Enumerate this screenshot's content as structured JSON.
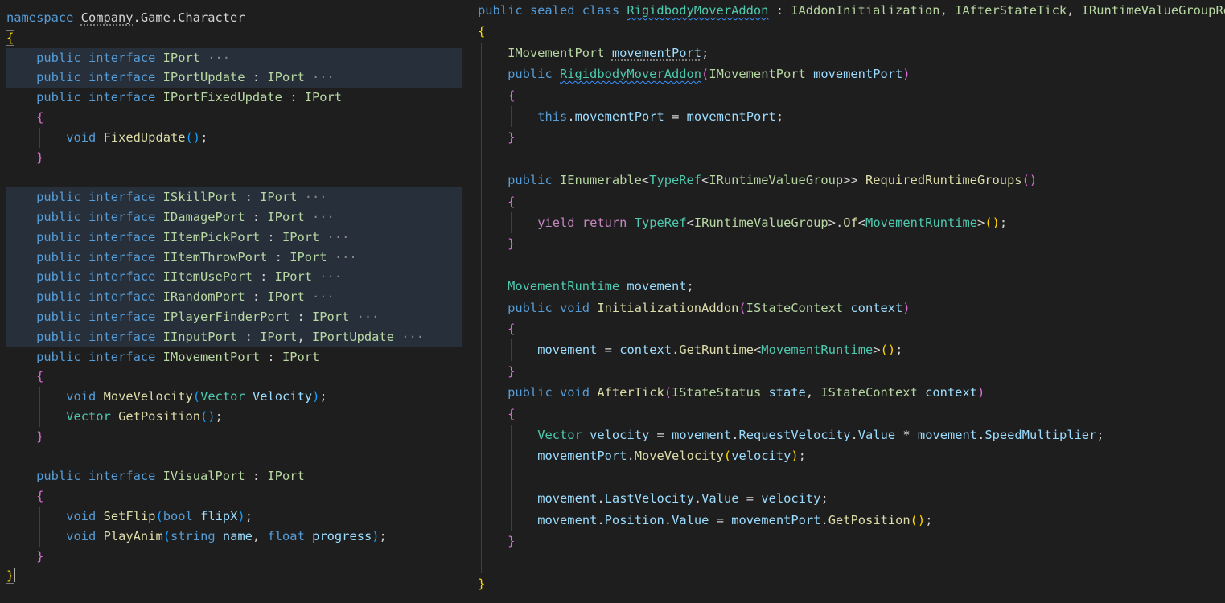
{
  "theme": {
    "keyword": "#569cd6",
    "control": "#c586c0",
    "type": "#4ec9b0",
    "iface": "#b8d7a3",
    "method": "#dcdcaa",
    "variable": "#9cdcfe",
    "text": "#d4d4d4",
    "brace1": "#ffd700",
    "brace2": "#da70d6",
    "brace3": "#179fff",
    "fold": "#8a8a8a"
  },
  "left_lines": [
    {
      "indent": 0,
      "hl": false,
      "tokens": [
        [
          "namespace ",
          "keyword"
        ],
        [
          "Company",
          "text",
          "dotted"
        ],
        [
          ".Game.Character",
          "text"
        ]
      ]
    },
    {
      "indent": 0,
      "hl": false,
      "tokens": [
        [
          "{",
          "brace1",
          "box"
        ]
      ]
    },
    {
      "indent": 1,
      "hl": true,
      "tokens": [
        [
          "public ",
          "keyword"
        ],
        [
          "interface ",
          "keyword"
        ],
        [
          "IPort",
          "iface"
        ],
        [
          " ···",
          "fold"
        ]
      ]
    },
    {
      "indent": 1,
      "hl": true,
      "tokens": [
        [
          "public ",
          "keyword"
        ],
        [
          "interface ",
          "keyword"
        ],
        [
          "IPortUpdate",
          "iface"
        ],
        [
          " : ",
          "text"
        ],
        [
          "IPort",
          "iface"
        ],
        [
          " ···",
          "fold"
        ]
      ]
    },
    {
      "indent": 1,
      "hl": false,
      "tokens": [
        [
          "public ",
          "keyword"
        ],
        [
          "interface ",
          "keyword"
        ],
        [
          "IPortFixedUpdate",
          "iface"
        ],
        [
          " : ",
          "text"
        ],
        [
          "IPort",
          "iface"
        ]
      ]
    },
    {
      "indent": 1,
      "hl": false,
      "tokens": [
        [
          "{",
          "brace2"
        ]
      ]
    },
    {
      "indent": 2,
      "hl": false,
      "tokens": [
        [
          "void ",
          "keyword"
        ],
        [
          "FixedUpdate",
          "method"
        ],
        [
          "()",
          "brace3"
        ],
        [
          ";",
          "text"
        ]
      ]
    },
    {
      "indent": 1,
      "hl": false,
      "tokens": [
        [
          "}",
          "brace2"
        ]
      ]
    },
    {
      "indent": 0,
      "hl": false,
      "tokens": []
    },
    {
      "indent": 1,
      "hl": true,
      "tokens": [
        [
          "public ",
          "keyword"
        ],
        [
          "interface ",
          "keyword"
        ],
        [
          "ISkillPort",
          "iface"
        ],
        [
          " : ",
          "text"
        ],
        [
          "IPort",
          "iface"
        ],
        [
          " ···",
          "fold"
        ]
      ]
    },
    {
      "indent": 1,
      "hl": true,
      "tokens": [
        [
          "public ",
          "keyword"
        ],
        [
          "interface ",
          "keyword"
        ],
        [
          "IDamagePort",
          "iface"
        ],
        [
          " : ",
          "text"
        ],
        [
          "IPort",
          "iface"
        ],
        [
          " ···",
          "fold"
        ]
      ]
    },
    {
      "indent": 1,
      "hl": true,
      "tokens": [
        [
          "public ",
          "keyword"
        ],
        [
          "interface ",
          "keyword"
        ],
        [
          "IItemPickPort",
          "iface"
        ],
        [
          " : ",
          "text"
        ],
        [
          "IPort",
          "iface"
        ],
        [
          " ···",
          "fold"
        ]
      ]
    },
    {
      "indent": 1,
      "hl": true,
      "tokens": [
        [
          "public ",
          "keyword"
        ],
        [
          "interface ",
          "keyword"
        ],
        [
          "IItemThrowPort",
          "iface"
        ],
        [
          " : ",
          "text"
        ],
        [
          "IPort",
          "iface"
        ],
        [
          " ···",
          "fold"
        ]
      ]
    },
    {
      "indent": 1,
      "hl": true,
      "tokens": [
        [
          "public ",
          "keyword"
        ],
        [
          "interface ",
          "keyword"
        ],
        [
          "IItemUsePort",
          "iface"
        ],
        [
          " : ",
          "text"
        ],
        [
          "IPort",
          "iface"
        ],
        [
          " ···",
          "fold"
        ]
      ]
    },
    {
      "indent": 1,
      "hl": true,
      "tokens": [
        [
          "public ",
          "keyword"
        ],
        [
          "interface ",
          "keyword"
        ],
        [
          "IRandomPort",
          "iface"
        ],
        [
          " : ",
          "text"
        ],
        [
          "IPort",
          "iface"
        ],
        [
          " ···",
          "fold"
        ]
      ]
    },
    {
      "indent": 1,
      "hl": true,
      "tokens": [
        [
          "public ",
          "keyword"
        ],
        [
          "interface ",
          "keyword"
        ],
        [
          "IPlayerFinderPort",
          "iface"
        ],
        [
          " : ",
          "text"
        ],
        [
          "IPort",
          "iface"
        ],
        [
          " ···",
          "fold"
        ]
      ]
    },
    {
      "indent": 1,
      "hl": true,
      "tokens": [
        [
          "public ",
          "keyword"
        ],
        [
          "interface ",
          "keyword"
        ],
        [
          "IInputPort",
          "iface"
        ],
        [
          " : ",
          "text"
        ],
        [
          "IPort",
          "iface"
        ],
        [
          ", ",
          "text"
        ],
        [
          "IPortUpdate",
          "iface"
        ],
        [
          " ···",
          "fold"
        ]
      ]
    },
    {
      "indent": 1,
      "hl": false,
      "tokens": [
        [
          "public ",
          "keyword"
        ],
        [
          "interface ",
          "keyword"
        ],
        [
          "IMovementPort",
          "iface"
        ],
        [
          " : ",
          "text"
        ],
        [
          "IPort",
          "iface"
        ]
      ]
    },
    {
      "indent": 1,
      "hl": false,
      "tokens": [
        [
          "{",
          "brace2"
        ]
      ]
    },
    {
      "indent": 2,
      "hl": false,
      "tokens": [
        [
          "void ",
          "keyword"
        ],
        [
          "MoveVelocity",
          "method"
        ],
        [
          "(",
          "brace3"
        ],
        [
          "Vector ",
          "type"
        ],
        [
          "Velocity",
          "variable"
        ],
        [
          ")",
          "brace3"
        ],
        [
          ";",
          "text"
        ]
      ]
    },
    {
      "indent": 2,
      "hl": false,
      "tokens": [
        [
          "Vector ",
          "type"
        ],
        [
          "GetPosition",
          "method"
        ],
        [
          "()",
          "brace3"
        ],
        [
          ";",
          "text"
        ]
      ]
    },
    {
      "indent": 1,
      "hl": false,
      "tokens": [
        [
          "}",
          "brace2"
        ]
      ]
    },
    {
      "indent": 0,
      "hl": false,
      "tokens": []
    },
    {
      "indent": 1,
      "hl": false,
      "tokens": [
        [
          "public ",
          "keyword"
        ],
        [
          "interface ",
          "keyword"
        ],
        [
          "IVisualPort",
          "iface"
        ],
        [
          " : ",
          "text"
        ],
        [
          "IPort",
          "iface"
        ]
      ]
    },
    {
      "indent": 1,
      "hl": false,
      "tokens": [
        [
          "{",
          "brace2"
        ]
      ]
    },
    {
      "indent": 2,
      "hl": false,
      "tokens": [
        [
          "void ",
          "keyword"
        ],
        [
          "SetFlip",
          "method"
        ],
        [
          "(",
          "brace3"
        ],
        [
          "bool ",
          "keyword"
        ],
        [
          "flipX",
          "variable"
        ],
        [
          ")",
          "brace3"
        ],
        [
          ";",
          "text"
        ]
      ]
    },
    {
      "indent": 2,
      "hl": false,
      "tokens": [
        [
          "void ",
          "keyword"
        ],
        [
          "PlayAnim",
          "method"
        ],
        [
          "(",
          "brace3"
        ],
        [
          "string ",
          "keyword"
        ],
        [
          "name",
          "variable"
        ],
        [
          ", ",
          "text"
        ],
        [
          "float ",
          "keyword"
        ],
        [
          "progress",
          "variable"
        ],
        [
          ")",
          "brace3"
        ],
        [
          ";",
          "text"
        ]
      ]
    },
    {
      "indent": 1,
      "hl": false,
      "tokens": [
        [
          "}",
          "brace2"
        ]
      ]
    },
    {
      "indent": 0,
      "hl": false,
      "tokens": [
        [
          "}",
          "brace1",
          "box"
        ],
        [
          "",
          "cursor"
        ]
      ]
    }
  ],
  "right_lines": [
    {
      "indent": 0,
      "tokens": [
        [
          "public ",
          "keyword"
        ],
        [
          "sealed ",
          "keyword"
        ],
        [
          "class ",
          "keyword"
        ],
        [
          "RigidbodyMoverAddon",
          "type",
          "squiggle"
        ],
        [
          " : ",
          "text"
        ],
        [
          "IAddonInitialization",
          "iface"
        ],
        [
          ", ",
          "text"
        ],
        [
          "IAfterStateTick",
          "iface"
        ],
        [
          ", ",
          "text"
        ],
        [
          "IRuntimeValueGroupRequirer",
          "iface"
        ]
      ]
    },
    {
      "indent": 0,
      "tokens": [
        [
          "{",
          "brace1"
        ]
      ]
    },
    {
      "indent": 1,
      "tokens": [
        [
          "IMovementPort ",
          "iface"
        ],
        [
          "movementPort",
          "variable",
          "dotted"
        ],
        [
          ";",
          "text"
        ]
      ]
    },
    {
      "indent": 1,
      "tokens": [
        [
          "public ",
          "keyword"
        ],
        [
          "RigidbodyMoverAddon",
          "type",
          "squiggle"
        ],
        [
          "(",
          "brace2"
        ],
        [
          "IMovementPort ",
          "iface"
        ],
        [
          "movementPort",
          "variable"
        ],
        [
          ")",
          "brace2"
        ]
      ]
    },
    {
      "indent": 1,
      "tokens": [
        [
          "{",
          "brace2"
        ]
      ]
    },
    {
      "indent": 2,
      "tokens": [
        [
          "this",
          "keyword"
        ],
        [
          ".",
          "text"
        ],
        [
          "movementPort",
          "variable"
        ],
        [
          " = ",
          "text"
        ],
        [
          "movementPort",
          "variable"
        ],
        [
          ";",
          "text"
        ]
      ]
    },
    {
      "indent": 1,
      "tokens": [
        [
          "}",
          "brace2"
        ]
      ]
    },
    {
      "indent": 0,
      "tokens": []
    },
    {
      "indent": 1,
      "tokens": [
        [
          "public ",
          "keyword"
        ],
        [
          "IEnumerable",
          "iface"
        ],
        [
          "<",
          "text"
        ],
        [
          "TypeRef",
          "type"
        ],
        [
          "<",
          "text"
        ],
        [
          "IRuntimeValueGroup",
          "iface"
        ],
        [
          ">> ",
          "text"
        ],
        [
          "RequiredRuntimeGroups",
          "method"
        ],
        [
          "()",
          "brace2"
        ]
      ]
    },
    {
      "indent": 1,
      "tokens": [
        [
          "{",
          "brace2"
        ]
      ]
    },
    {
      "indent": 2,
      "tokens": [
        [
          "yield ",
          "control"
        ],
        [
          "return ",
          "control"
        ],
        [
          "TypeRef",
          "type"
        ],
        [
          "<",
          "text"
        ],
        [
          "IRuntimeValueGroup",
          "iface"
        ],
        [
          ">.",
          "text"
        ],
        [
          "Of",
          "method"
        ],
        [
          "<",
          "text"
        ],
        [
          "MovementRuntime",
          "type"
        ],
        [
          ">",
          "text"
        ],
        [
          "()",
          "brace1"
        ],
        [
          ";",
          "text"
        ]
      ]
    },
    {
      "indent": 1,
      "tokens": [
        [
          "}",
          "brace2"
        ]
      ]
    },
    {
      "indent": 0,
      "tokens": []
    },
    {
      "indent": 1,
      "tokens": [
        [
          "MovementRuntime ",
          "type"
        ],
        [
          "movement",
          "variable"
        ],
        [
          ";",
          "text"
        ]
      ]
    },
    {
      "indent": 1,
      "tokens": [
        [
          "public ",
          "keyword"
        ],
        [
          "void ",
          "keyword"
        ],
        [
          "InitializationAddon",
          "method"
        ],
        [
          "(",
          "brace2"
        ],
        [
          "IStateContext ",
          "iface"
        ],
        [
          "context",
          "variable"
        ],
        [
          ")",
          "brace2"
        ]
      ]
    },
    {
      "indent": 1,
      "tokens": [
        [
          "{",
          "brace2"
        ]
      ]
    },
    {
      "indent": 2,
      "tokens": [
        [
          "movement",
          "variable"
        ],
        [
          " = ",
          "text"
        ],
        [
          "context",
          "variable"
        ],
        [
          ".",
          "text"
        ],
        [
          "GetRuntime",
          "method"
        ],
        [
          "<",
          "text"
        ],
        [
          "MovementRuntime",
          "type"
        ],
        [
          ">",
          "text"
        ],
        [
          "()",
          "brace1"
        ],
        [
          ";",
          "text"
        ]
      ]
    },
    {
      "indent": 1,
      "tokens": [
        [
          "}",
          "brace2"
        ]
      ]
    },
    {
      "indent": 1,
      "tokens": [
        [
          "public ",
          "keyword"
        ],
        [
          "void ",
          "keyword"
        ],
        [
          "AfterTick",
          "method"
        ],
        [
          "(",
          "brace2"
        ],
        [
          "IStateStatus ",
          "iface"
        ],
        [
          "state",
          "variable"
        ],
        [
          ", ",
          "text"
        ],
        [
          "IStateContext ",
          "iface"
        ],
        [
          "context",
          "variable"
        ],
        [
          ")",
          "brace2"
        ]
      ]
    },
    {
      "indent": 1,
      "tokens": [
        [
          "{",
          "brace2"
        ]
      ]
    },
    {
      "indent": 2,
      "tokens": [
        [
          "Vector ",
          "type"
        ],
        [
          "velocity",
          "variable"
        ],
        [
          " = ",
          "text"
        ],
        [
          "movement",
          "variable"
        ],
        [
          ".",
          "text"
        ],
        [
          "RequestVelocity",
          "variable"
        ],
        [
          ".",
          "text"
        ],
        [
          "Value",
          "variable"
        ],
        [
          " * ",
          "text"
        ],
        [
          "movement",
          "variable"
        ],
        [
          ".",
          "text"
        ],
        [
          "SpeedMultiplier",
          "variable"
        ],
        [
          ";",
          "text"
        ]
      ]
    },
    {
      "indent": 2,
      "tokens": [
        [
          "movementPort",
          "variable"
        ],
        [
          ".",
          "text"
        ],
        [
          "MoveVelocity",
          "method"
        ],
        [
          "(",
          "brace1"
        ],
        [
          "velocity",
          "variable"
        ],
        [
          ")",
          "brace1"
        ],
        [
          ";",
          "text"
        ]
      ]
    },
    {
      "indent": 0,
      "tokens": []
    },
    {
      "indent": 2,
      "tokens": [
        [
          "movement",
          "variable"
        ],
        [
          ".",
          "text"
        ],
        [
          "LastVelocity",
          "variable"
        ],
        [
          ".",
          "text"
        ],
        [
          "Value",
          "variable"
        ],
        [
          " = ",
          "text"
        ],
        [
          "velocity",
          "variable"
        ],
        [
          ";",
          "text"
        ]
      ]
    },
    {
      "indent": 2,
      "tokens": [
        [
          "movement",
          "variable"
        ],
        [
          ".",
          "text"
        ],
        [
          "Position",
          "variable"
        ],
        [
          ".",
          "text"
        ],
        [
          "Value",
          "variable"
        ],
        [
          " = ",
          "text"
        ],
        [
          "movementPort",
          "variable"
        ],
        [
          ".",
          "text"
        ],
        [
          "GetPosition",
          "method"
        ],
        [
          "()",
          "brace1"
        ],
        [
          ";",
          "text"
        ]
      ]
    },
    {
      "indent": 1,
      "tokens": [
        [
          "}",
          "brace2"
        ]
      ]
    },
    {
      "indent": 0,
      "tokens": []
    },
    {
      "indent": 0,
      "tokens": [
        [
          "}",
          "brace1"
        ]
      ]
    }
  ]
}
